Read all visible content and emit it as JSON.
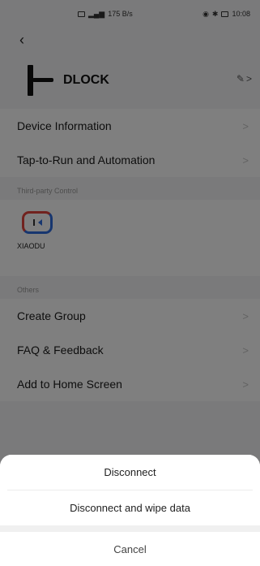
{
  "status_bar": {
    "network_icons": "signal-wifi-icons",
    "speed": "175 B/s",
    "time": "10:08"
  },
  "device": {
    "name": "DLOCK"
  },
  "menu": {
    "device_information": "Device Information",
    "tap_to_run": "Tap-to-Run and Automation",
    "chevron": ">"
  },
  "sections": {
    "third_party": "Third-party Control",
    "others": "Others"
  },
  "third_party": {
    "xiaodu_label": "XIAODU"
  },
  "others": {
    "create_group": "Create Group",
    "faq": "FAQ & Feedback",
    "add_home": "Add to Home Screen"
  },
  "sheet": {
    "disconnect": "Disconnect",
    "disconnect_wipe": "Disconnect and wipe data",
    "cancel": "Cancel"
  }
}
